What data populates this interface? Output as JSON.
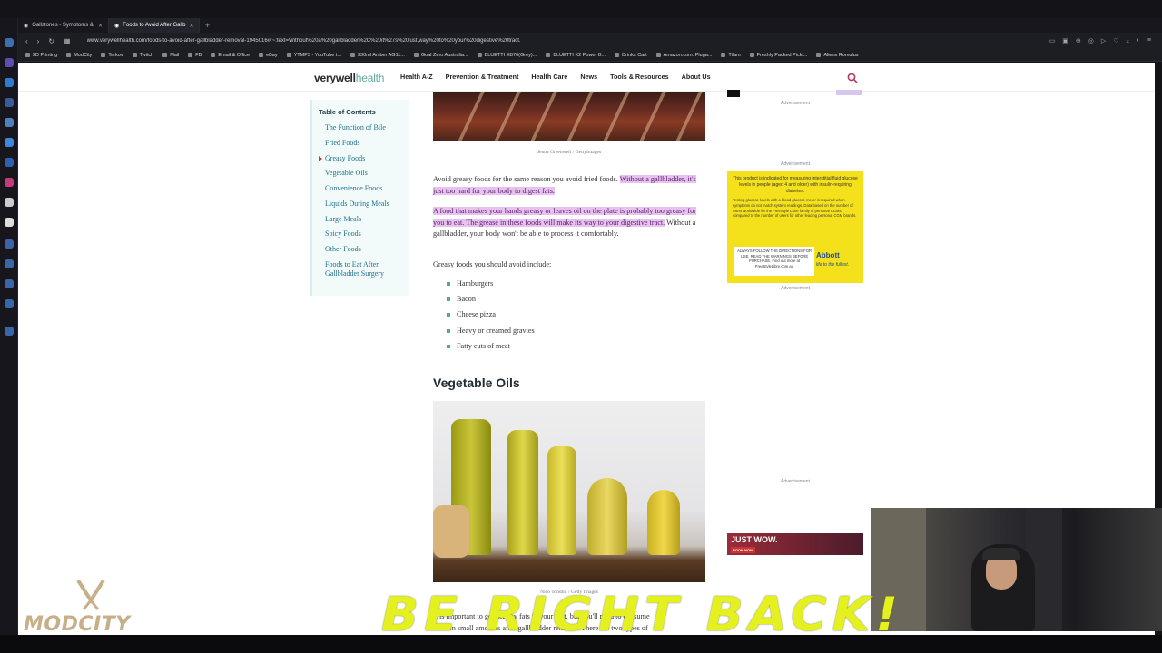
{
  "browser": {
    "tabs": [
      {
        "label": "Gallstones - Symptoms &"
      },
      {
        "label": "Foods to Avoid After Gallb"
      }
    ],
    "url": "www.verywellhealth.com/foods-to-avoid-after-gallbladder-removal-1945016#:~:text=Without%20a%20gallbladder%2C%20it%27s%20just,way%20to%20your%20digestive%20tract.",
    "bookmarks": [
      "3D Printing",
      "ModCity",
      "Tarkov",
      "Twitch",
      "Mail",
      "FB",
      "Email & Office",
      "eBay",
      "YTMP3 - YouTube t...",
      "330ml Amber AG11...",
      "Goal Zero Australia...",
      "BLUETTI EB70(Grey)...",
      "BLUETTI K2 Power B...",
      "Drinks Cart",
      "Amazon.com: Pluga...",
      "Tilam",
      "Freshly Packed Pickl...",
      "Aliens Romulus"
    ]
  },
  "site": {
    "logo_main": "verywell",
    "logo_sub": "health",
    "nav": [
      "Health A-Z",
      "Prevention & Treatment",
      "Health Care",
      "News",
      "Tools & Resources",
      "About Us"
    ]
  },
  "toc": {
    "title": "Table of Contents",
    "items": [
      "The Function of Bile",
      "Fried Foods",
      "Greasy Foods",
      "Vegetable Oils",
      "Convenience Foods",
      "Liquids During Meals",
      "Large Meals",
      "Spicy Foods",
      "Other Foods",
      "Foods to Eat After Gallbladder Surgery"
    ],
    "active_index": 2
  },
  "article": {
    "caption1": "Jenna Greenwell / GettyImages",
    "para1_plain": "Avoid greasy foods for the same reason you avoid fried foods. ",
    "para1_hl": "Without a gallbladder, it's just too hard for your body to digest fats.",
    "para2_hl": "A food that makes your hands greasy or leaves oil on the plate is probably too greasy for you to eat. The grease in these foods will make its way to your digestive tract.",
    "para2_plain": " Without a gallbladder, your body won't be able to process it comfortably.",
    "list_intro": "Greasy foods you should avoid include:",
    "list": [
      "Hamburgers",
      "Bacon",
      "Cheese pizza",
      "Heavy or creamed gravies",
      "Fatty cuts of meat"
    ],
    "heading": "Vegetable Oils",
    "caption2": "Nico Tondini / Getty Images",
    "bottom_line1": "It is important to get healthy fats in your diet, but you'll need to consume",
    "bottom_line2": "them in small amounts after gallbladder removal. There are two types of"
  },
  "ads": {
    "label": "Advertisement",
    "yellow_main": "This product is indicated for measuring interstitial fluid glucose levels in people (aged 4 and older) with insulin-requiring diabetes.",
    "yellow_fine": "Testing glucose levels with a blood glucose meter is required when symptoms do not match system readings. Data based on the number of users worldwide for the FreeStyle Libre family of personal CGMs compared to the number of users for other leading personal CGM brands.",
    "yellow_warn": "ALWAYS FOLLOW THE DIRECTIONS FOR USE. READ THE WARNINGS BEFORE PURCHASE. Find out more at FreeStyleLibre.com.au",
    "abbott": "Abbott",
    "abbott_tag": "life to the fullest.",
    "small_title": "JUST WOW.",
    "small_sub": "BOOK NOW"
  },
  "overlay": {
    "brb": "BE RIGHT BACK!",
    "brand": "MODCITY"
  }
}
